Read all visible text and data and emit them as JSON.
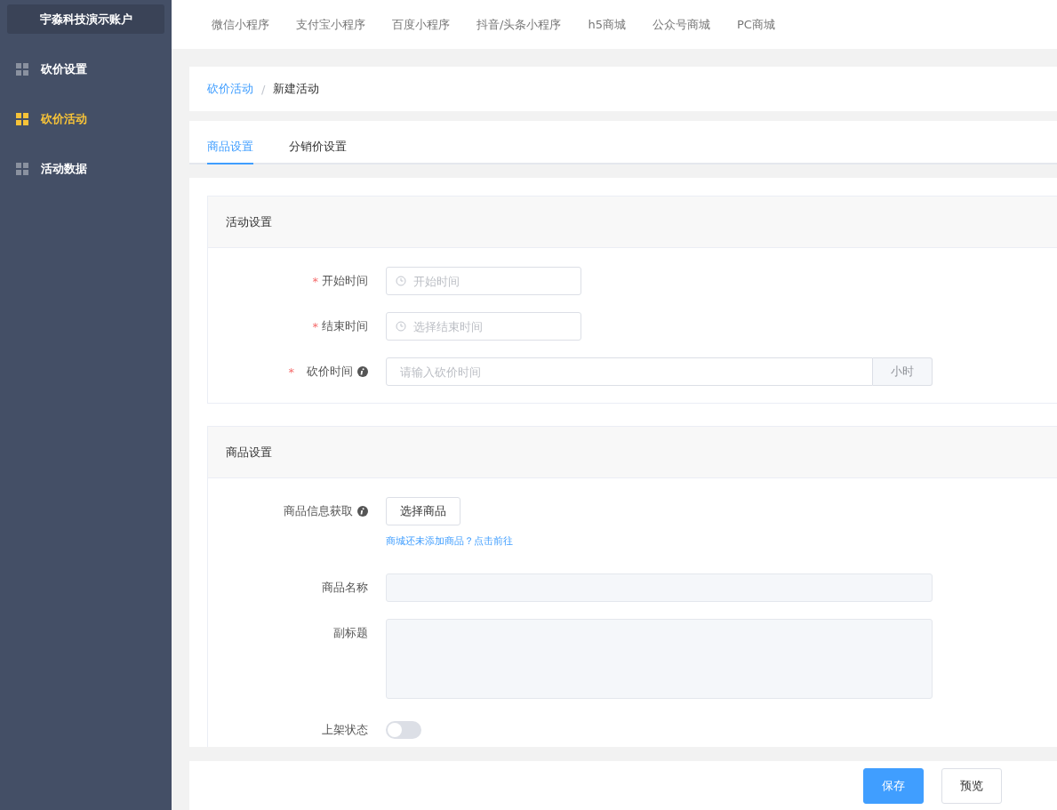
{
  "sidebar": {
    "account": "宇淼科技演示账户",
    "items": [
      {
        "label": "砍价设置",
        "selected": false
      },
      {
        "label": "砍价活动",
        "selected": true
      },
      {
        "label": "活动数据",
        "selected": false
      }
    ]
  },
  "top_nav": [
    "微信小程序",
    "支付宝小程序",
    "百度小程序",
    "抖音/头条小程序",
    "h5商城",
    "公众号商城",
    "PC商城"
  ],
  "breadcrumb_separator": "/",
  "breadcrumb": [
    {
      "label": "砍价活动",
      "link": true
    },
    {
      "label": "新建活动",
      "link": false
    }
  ],
  "tabs": [
    {
      "label": "商品设置",
      "selected": true
    },
    {
      "label": "分销价设置",
      "selected": false
    }
  ],
  "sections": [
    {
      "title": "活动设置",
      "fields": [
        {
          "kind": "date",
          "label": "开始时间",
          "required": "*",
          "info": false,
          "placeholder": "开始时间"
        },
        {
          "kind": "date",
          "label": "结束时间",
          "required": "*",
          "info": false,
          "placeholder": "选择结束时间"
        },
        {
          "kind": "addon",
          "label": "砍价时间",
          "required": "*",
          "info": true,
          "placeholder": "请输入砍价时间",
          "addon": "小时"
        }
      ]
    },
    {
      "title": "商品设置",
      "fields": [
        {
          "kind": "pick",
          "label": "商品信息获取",
          "info": true,
          "button": "选择商品",
          "hint": "商城还未添加商品？点击前往"
        },
        {
          "kind": "input",
          "label": "商品名称",
          "info": false
        },
        {
          "kind": "textarea",
          "label": "副标题",
          "info": false
        },
        {
          "kind": "switch",
          "label": "上架状态",
          "info": false,
          "on": false
        }
      ]
    }
  ],
  "footer_buttons": [
    {
      "label": "保存",
      "kind": "primary"
    },
    {
      "label": "预览",
      "kind": "default"
    }
  ]
}
